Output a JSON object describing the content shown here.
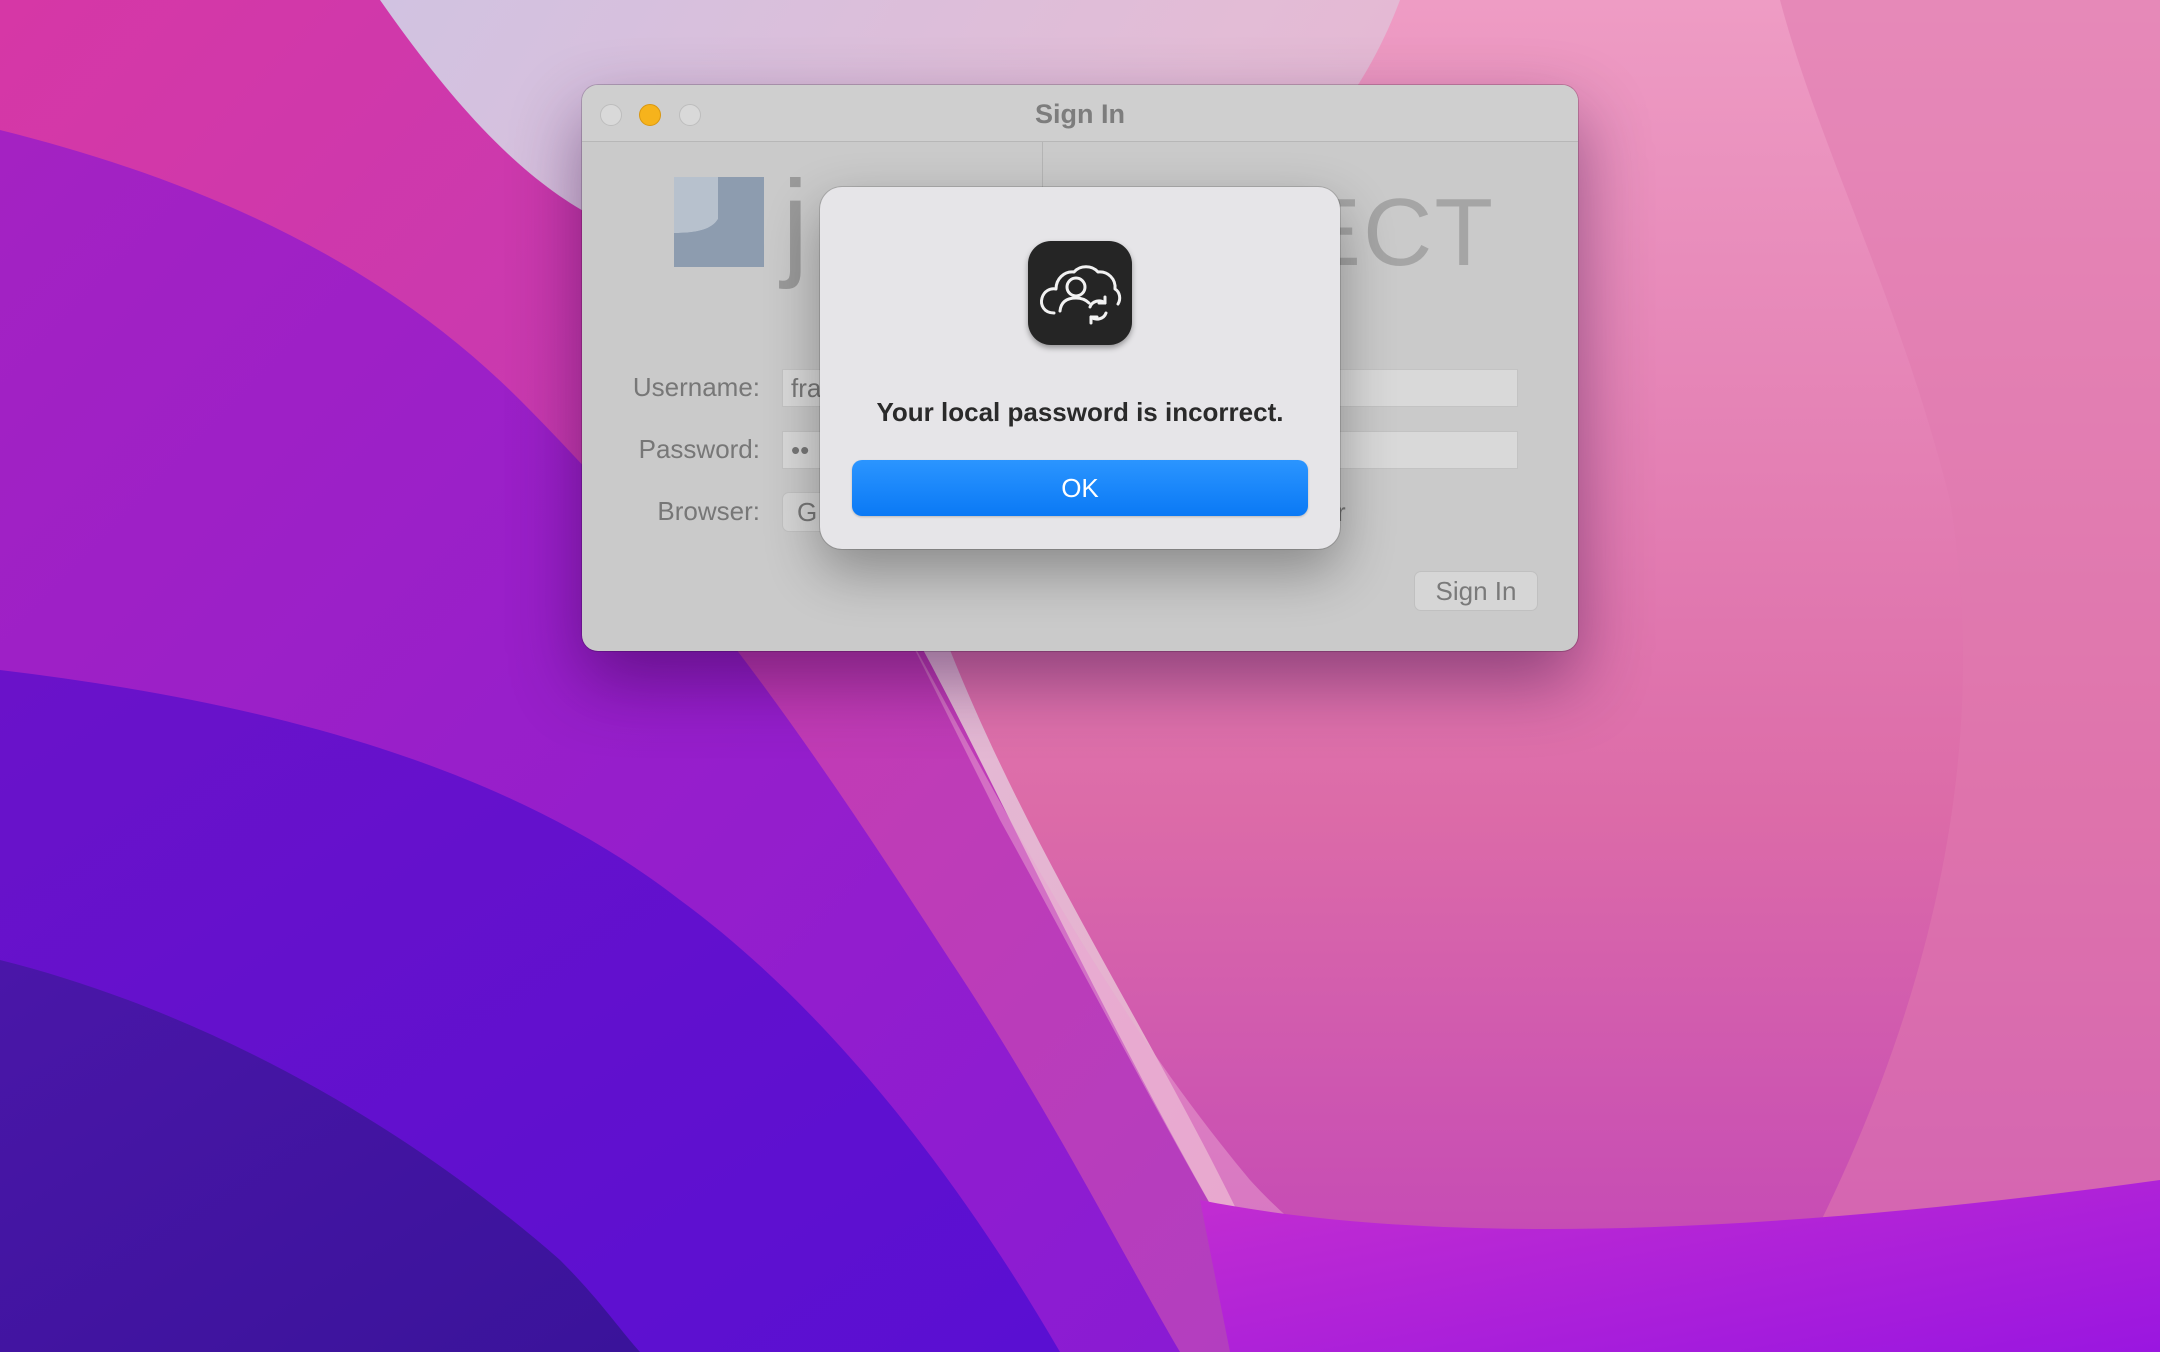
{
  "window": {
    "title": "Sign In",
    "logo_text": "j",
    "logo_suffix": "ECT",
    "fields": {
      "username_label": "Username:",
      "username_value": "fra",
      "password_label": "Password:",
      "password_value": "••",
      "browser_label": "Browser:",
      "browser_value": "G",
      "browser_tail": "r"
    },
    "sign_in_button": "Sign In"
  },
  "alert": {
    "icon": "cloud-user-sync-icon",
    "message": "Your local password is incorrect.",
    "ok_button": "OK",
    "accent_color": "#0a79f5"
  }
}
